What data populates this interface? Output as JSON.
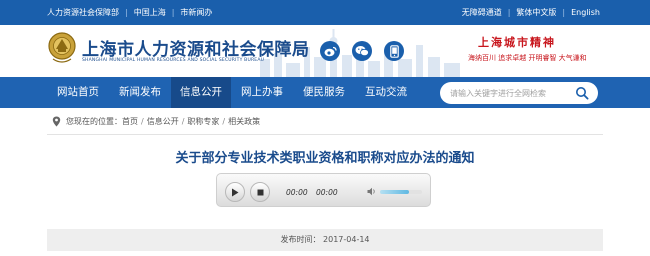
{
  "topbar": {
    "left_links": [
      "人力资源社会保障部",
      "中国上海",
      "市新闻办"
    ],
    "right_links": [
      "无障碍通道",
      "繁体中文版",
      "English"
    ]
  },
  "header": {
    "title": "上海市人力资源和社会保障局",
    "subtitle": "SHANGHAI MUNICIPAL HUMAN RESOURCES AND SOCIAL SECURITY BUREAU",
    "social_icons": [
      "weibo-icon",
      "wechat-icon",
      "mobile-icon"
    ],
    "slogan": {
      "title": "上海城市精神",
      "line": "海纳百川  追求卓越  开明睿智  大气谦和"
    }
  },
  "nav": {
    "items": [
      {
        "label": "网站首页",
        "active": false
      },
      {
        "label": "新闻发布",
        "active": false
      },
      {
        "label": "信息公开",
        "active": true
      },
      {
        "label": "网上办事",
        "active": false
      },
      {
        "label": "便民服务",
        "active": false
      },
      {
        "label": "互动交流",
        "active": false
      }
    ]
  },
  "search": {
    "placeholder": "请输入关键字进行全网检索"
  },
  "breadcrumb": {
    "label": "您现在的位置：",
    "items": [
      "首页",
      "信息公开",
      "职称专家",
      "相关政策"
    ]
  },
  "article": {
    "title": "关于部分专业技术类职业资格和职称对应办法的通知",
    "publish_label": "发布时间：",
    "publish_date": "2017-04-14"
  },
  "player": {
    "current_time": "00:00",
    "duration": "00:00",
    "volume_fraction": 0.7
  },
  "colors": {
    "brand_blue": "#1a5fac",
    "nav_active": "#174a8a",
    "title_blue": "#1a4b8c",
    "slogan_red": "#c8161d"
  }
}
